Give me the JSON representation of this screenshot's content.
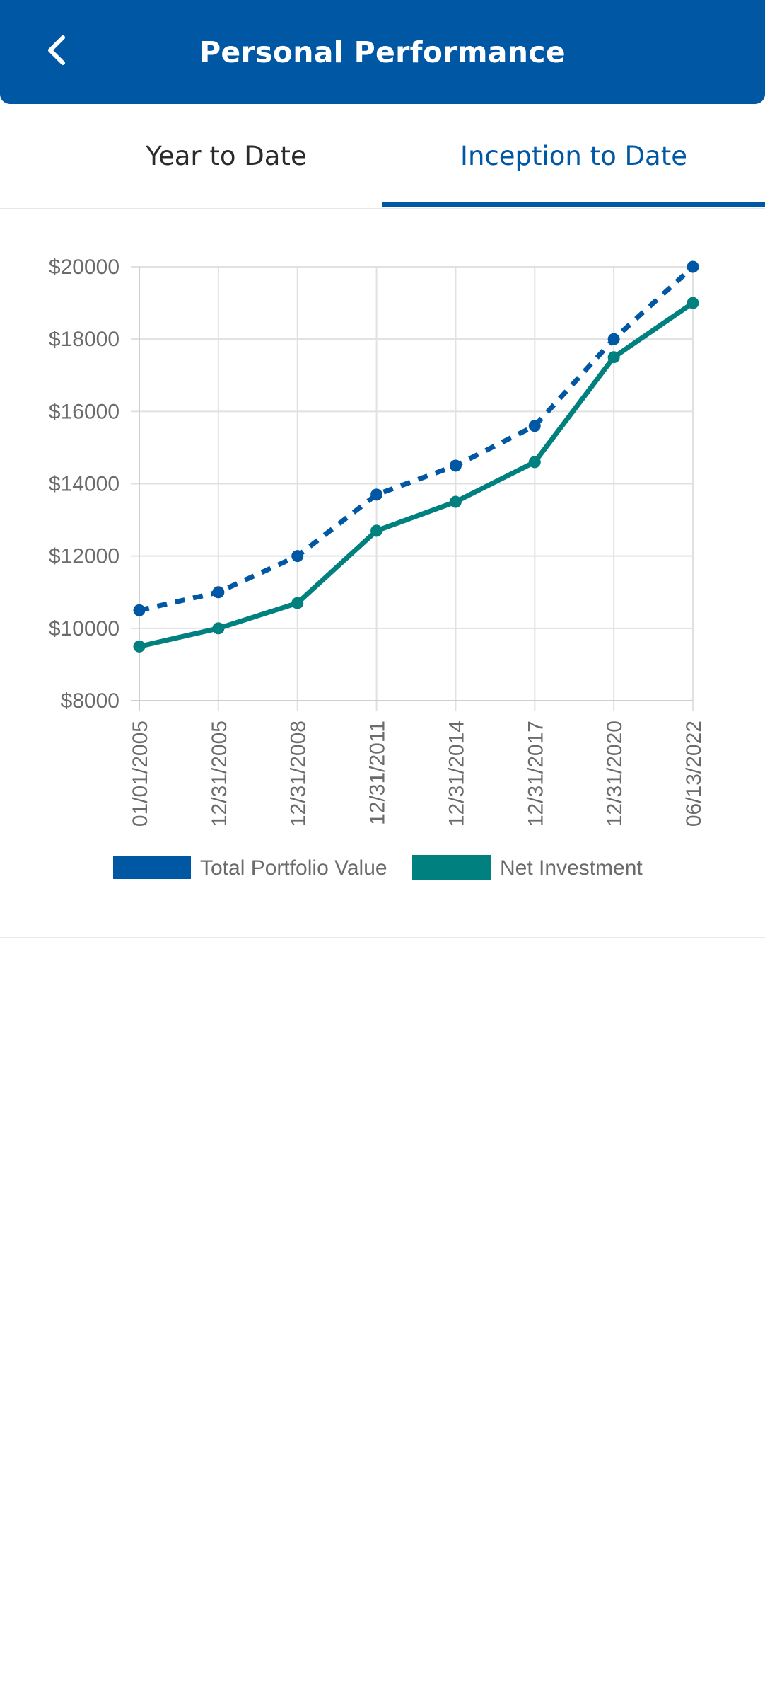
{
  "header": {
    "title": "Personal Performance",
    "back_icon": "chevron-left-icon"
  },
  "tabs": [
    {
      "label": "Year to Date",
      "active": false
    },
    {
      "label": "Inception to Date",
      "active": true
    }
  ],
  "colors": {
    "brand_blue": "#0057a3",
    "teal": "#00807f",
    "axis_text": "#6b6b6b",
    "grid": "#e1e1e1"
  },
  "chart_data": {
    "type": "line",
    "categories": [
      "01/01/2005",
      "12/31/2005",
      "12/31/2008",
      "12/31/2011",
      "12/31/2014",
      "12/31/2017",
      "12/31/2020",
      "06/13/2022"
    ],
    "y_ticks": [
      "$8000",
      "$10000",
      "$12000",
      "$14000",
      "$16000",
      "$18000",
      "$20000"
    ],
    "ylim": [
      8000,
      20000
    ],
    "grid": true,
    "legend_position": "bottom",
    "series": [
      {
        "name": "Total Portfolio Value",
        "style": "dashed",
        "color": "#0057a3",
        "values": [
          10500,
          11000,
          12000,
          13700,
          14500,
          15600,
          18000,
          20000
        ]
      },
      {
        "name": "Net Investment",
        "style": "solid",
        "color": "#00807f",
        "values": [
          9500,
          10000,
          10700,
          12700,
          13500,
          14600,
          17500,
          19000
        ]
      }
    ]
  }
}
